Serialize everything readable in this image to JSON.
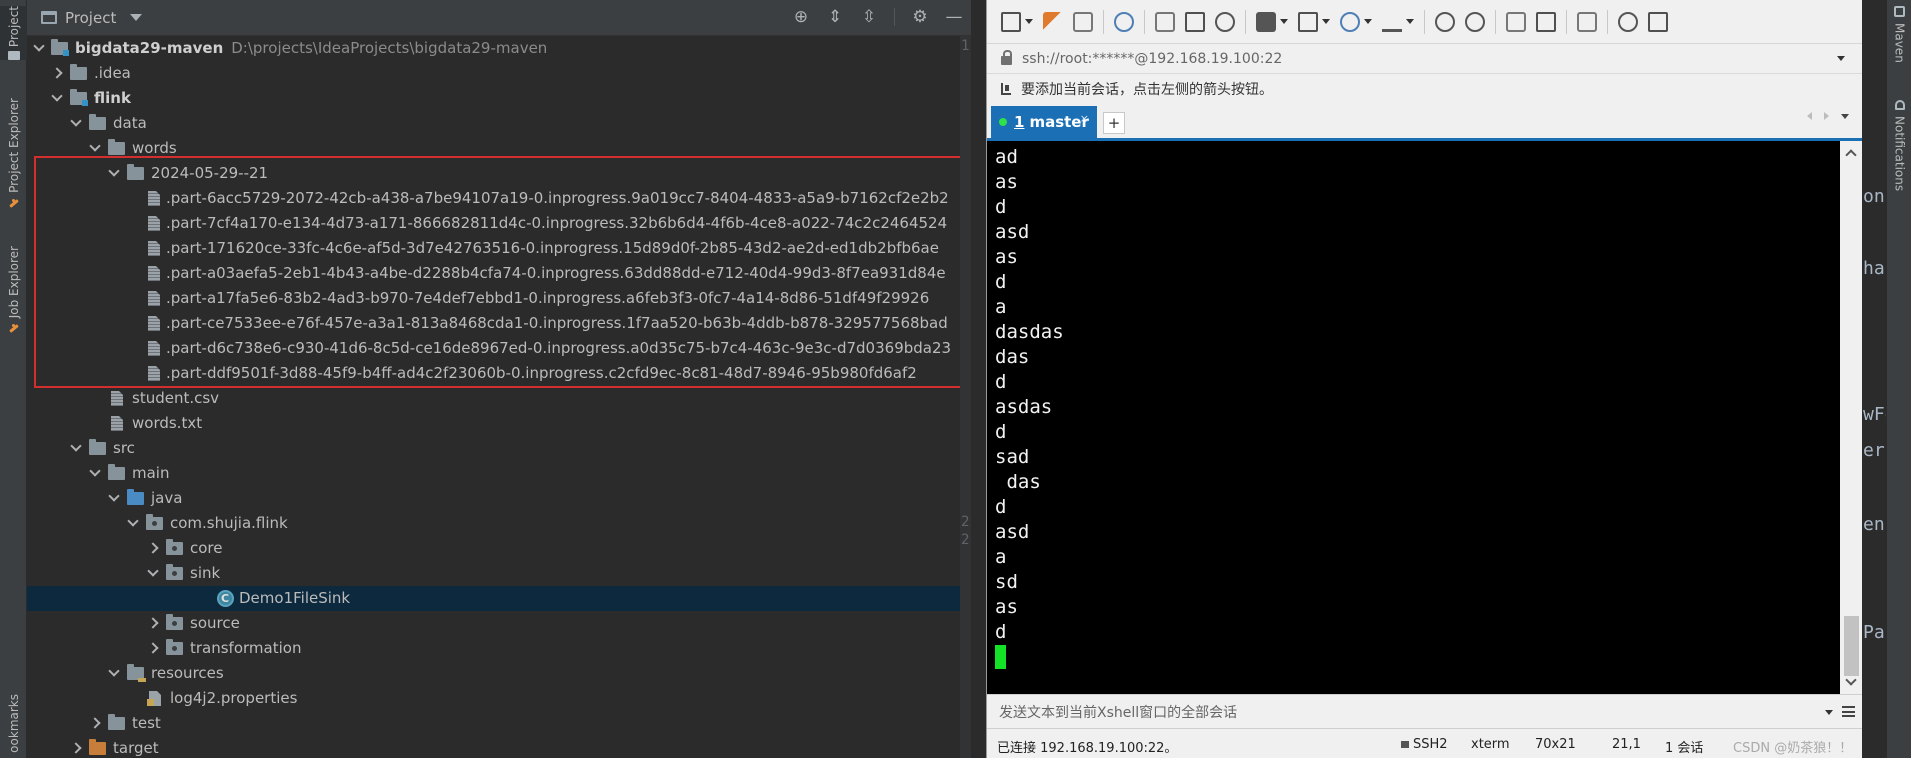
{
  "left_strip": {
    "tabs": [
      {
        "label": "Project",
        "icon": "folder-icon"
      },
      {
        "label": "Project Explorer",
        "icon": "project-explorer-icon"
      },
      {
        "label": "Job Explorer",
        "icon": "job-explorer-icon"
      },
      {
        "label": "ookmarks",
        "icon": "bookmarks-icon"
      }
    ]
  },
  "project": {
    "title": "Project",
    "actions": [
      "crosshair-icon",
      "expand-all-icon",
      "collapse-all-icon",
      "gear-icon",
      "minimize-icon"
    ],
    "tree": [
      {
        "label": "bigdata29-maven",
        "path": "D:\\projects\\IdeaProjects\\bigdata29-maven",
        "bold": true
      },
      {
        "label": ".idea"
      },
      {
        "label": "flink",
        "bold": true
      },
      {
        "label": "data"
      },
      {
        "label": "words"
      },
      {
        "label": "2024-05-29--21"
      },
      {
        "label": ".part-6acc5729-2072-42cb-a438-a7be94107a19-0.inprogress.9a019cc7-8404-4833-a5a9-b7162cf2e2b2"
      },
      {
        "label": ".part-7cf4a170-e134-4d73-a171-866682811d4c-0.inprogress.32b6b6d4-4f6b-4ce8-a022-74c2c2464524"
      },
      {
        "label": ".part-171620ce-33fc-4c6e-af5d-3d7e42763516-0.inprogress.15d89d0f-2b85-43d2-ae2d-ed1db2bfb6ae"
      },
      {
        "label": ".part-a03aefa5-2eb1-4b43-a4be-d2288b4cfa74-0.inprogress.63dd88dd-e712-40d4-99d3-8f7ea931d84e"
      },
      {
        "label": ".part-a17fa5e6-83b2-4ad3-b970-7e4def7ebbd1-0.inprogress.a6feb3f3-0fc7-4a14-8d86-51df49f29926"
      },
      {
        "label": ".part-ce7533ee-e76f-457e-a3a1-813a8468cda1-0.inprogress.1f7aa520-b63b-4ddb-b878-329577568bad"
      },
      {
        "label": ".part-d6c738e6-c930-41d6-8c5d-ce16de8967ed-0.inprogress.a0d35c75-b7c4-463c-9e3c-d7d0369bda23"
      },
      {
        "label": ".part-ddf9501f-3d88-45f9-b4ff-ad4c2f23060b-0.inprogress.c2cfd9ec-8c81-48d7-8946-95b980fd6af2"
      },
      {
        "label": "student.csv"
      },
      {
        "label": "words.txt"
      },
      {
        "label": "src"
      },
      {
        "label": "main"
      },
      {
        "label": "java"
      },
      {
        "label": "com.shujia.flink"
      },
      {
        "label": "core"
      },
      {
        "label": "sink"
      },
      {
        "label": "Demo1FileSink",
        "selected": true
      },
      {
        "label": "source"
      },
      {
        "label": "transformation"
      },
      {
        "label": "resources"
      },
      {
        "label": "log4j2.properties"
      },
      {
        "label": "test"
      },
      {
        "label": "target"
      }
    ],
    "gutter_numbers": [
      "1",
      "2",
      "2"
    ]
  },
  "xshell": {
    "address": "ssh://root:******@192.168.19.100:22",
    "hint": "要添加当前会话，点击左侧的箭头按钮。",
    "tab": {
      "number": "1",
      "label": "master",
      "close": "×"
    },
    "new_tab": "+",
    "terminal_lines": [
      "ad",
      "as",
      "d",
      "asd",
      "as",
      "d",
      "a",
      "dasdas",
      "das",
      "d",
      "asdas",
      "d",
      "sad",
      " das",
      "d",
      "asd",
      "a",
      "sd",
      "as",
      "d"
    ],
    "send_placeholder": "发送文本到当前Xshell窗口的全部会话",
    "status": {
      "connected": "已连接 192.168.19.100:22。",
      "protocol": "SSH2",
      "term": "xterm",
      "size": "70x21",
      "pos": "21,1",
      "sessions": "1 会话",
      "watermark": "CSDN @奶茶狼！！"
    },
    "colors": {
      "tab_active": "#1a6fb5",
      "cursor": "#13e227",
      "terminal_bg": "#000000"
    }
  },
  "right_editor": {
    "fragments": [
      {
        "text": "onn"
      },
      {
        "text": "han"
      },
      {
        "text": "wFo"
      },
      {
        "text": "eri"
      },
      {
        "text": "en"
      },
      {
        "text": "Pa"
      }
    ]
  },
  "right_strip": {
    "tabs": [
      {
        "label": "Maven",
        "icon": "maven-icon"
      },
      {
        "label": "Notifications",
        "icon": "bell-icon"
      }
    ]
  }
}
